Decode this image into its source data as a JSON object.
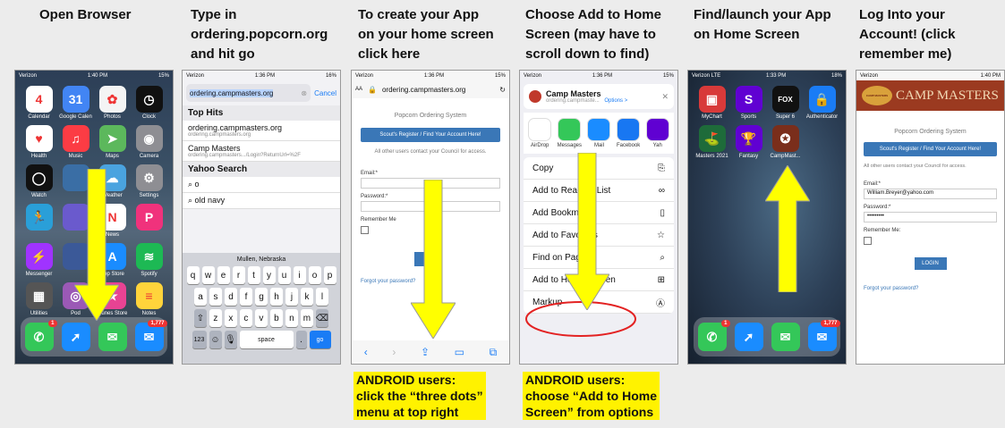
{
  "steps": [
    {
      "title": "Open Browser"
    },
    {
      "title": "Type in\nordering.popcorn.org\nand hit go"
    },
    {
      "title": "To create your App\non your home screen\nclick here"
    },
    {
      "title": "Choose Add to Home\nScreen (may have to\nscroll down to find)"
    },
    {
      "title": "Find/launch your App\non Home Screen"
    },
    {
      "title": "Log Into your\nAccount! (click\nremember me)"
    }
  ],
  "colors": {
    "arrow": "#ffff00",
    "highlight": "#fff200",
    "button_blue": "#3a77b7"
  },
  "phone1": {
    "status": {
      "carrier": "Verizon",
      "time": "1:40 PM",
      "battery": "15%"
    },
    "apps": [
      {
        "label": "Calendar",
        "glyph": "4",
        "color": "#ffffff",
        "icon": "calendar-icon"
      },
      {
        "label": "Google Calen",
        "glyph": "31",
        "color": "#4285f4",
        "icon": "google-calendar-icon"
      },
      {
        "label": "Photos",
        "glyph": "✿",
        "color": "#f4f4f4",
        "icon": "photos-icon"
      },
      {
        "label": "Clock",
        "glyph": "◷",
        "color": "#111111",
        "icon": "clock-icon"
      },
      {
        "label": "Health",
        "glyph": "♥",
        "color": "#ffffff",
        "icon": "health-icon"
      },
      {
        "label": "Music",
        "glyph": "♫",
        "color": "#fc3c44",
        "icon": "music-icon"
      },
      {
        "label": "Maps",
        "glyph": "➤",
        "color": "#5cb85c",
        "icon": "maps-icon"
      },
      {
        "label": "Camera",
        "glyph": "◉",
        "color": "#8e8e93",
        "icon": "camera-icon"
      },
      {
        "label": "Watch",
        "glyph": "◯",
        "color": "#111111",
        "icon": "watch-icon"
      },
      {
        "label": "",
        "glyph": "",
        "color": "#3a6ea5",
        "icon": "app-icon"
      },
      {
        "label": "Weather",
        "glyph": "☁",
        "color": "#4aa3df",
        "icon": "weather-icon"
      },
      {
        "label": "Settings",
        "glyph": "⚙",
        "color": "#8e8e93",
        "icon": "settings-icon"
      },
      {
        "label": "",
        "glyph": "🏃",
        "color": "#2a9fd8",
        "icon": "fitness-icon"
      },
      {
        "label": "",
        "glyph": "",
        "color": "#6a5acd",
        "icon": "app-icon"
      },
      {
        "label": "News",
        "glyph": "N",
        "color": "#ffffff",
        "icon": "news-icon"
      },
      {
        "label": "",
        "glyph": "P",
        "color": "#f0327c",
        "icon": "app-icon"
      },
      {
        "label": "Messenger",
        "glyph": "⚡",
        "color": "#a033ff",
        "icon": "messenger-icon"
      },
      {
        "label": "",
        "glyph": "",
        "color": "#3b5998",
        "icon": "app-icon"
      },
      {
        "label": "App Store",
        "glyph": "A",
        "color": "#1a8cff",
        "icon": "app-store-icon"
      },
      {
        "label": "Spotify",
        "glyph": "≋",
        "color": "#1db954",
        "icon": "spotify-icon"
      },
      {
        "label": "Utilities",
        "glyph": "▦",
        "color": "#555555",
        "icon": "utilities-folder-icon"
      },
      {
        "label": "Pod",
        "glyph": "◎",
        "color": "#9b59b6",
        "icon": "podcasts-icon"
      },
      {
        "label": "iTunes Store",
        "glyph": "★",
        "color": "#e84393",
        "icon": "itunes-store-icon"
      },
      {
        "label": "Notes",
        "glyph": "≡",
        "color": "#ffd43b",
        "icon": "notes-icon"
      }
    ],
    "dock": [
      {
        "glyph": "✆",
        "color": "#34c759",
        "icon": "phone-icon",
        "badge": "1"
      },
      {
        "glyph": "➚",
        "color": "#1a8cff",
        "icon": "safari-icon",
        "badge": ""
      },
      {
        "glyph": "✉",
        "color": "#34c759",
        "icon": "messages-icon",
        "badge": ""
      },
      {
        "glyph": "✉",
        "color": "#1a8cff",
        "icon": "mail-icon",
        "badge": "1,777"
      }
    ]
  },
  "phone2": {
    "status": {
      "carrier": "Verizon",
      "time": "1:36 PM",
      "battery": "16%"
    },
    "url": "ordering.campmasters.org",
    "cancel": "Cancel",
    "top_hits": "Top Hits",
    "hit1": {
      "title": "ordering.campmasters.org",
      "sub": "ordering.campmasters.org"
    },
    "hit2": {
      "title": "Camp Masters",
      "sub": "ordering.campmasters.../Login?ReturnUrl=%2F"
    },
    "yahoo": "Yahoo Search",
    "s1": "o",
    "s2": "old navy",
    "location": "Mullen, Nebraska",
    "keys_row1": [
      "q",
      "w",
      "e",
      "r",
      "t",
      "y",
      "u",
      "i",
      "o",
      "p"
    ],
    "keys_row2": [
      "a",
      "s",
      "d",
      "f",
      "g",
      "h",
      "j",
      "k",
      "l"
    ],
    "keys_row3": [
      "z",
      "x",
      "c",
      "v",
      "b",
      "n",
      "m"
    ],
    "key_123": "123",
    "key_space": "space",
    "key_go": "go"
  },
  "phone3": {
    "status": {
      "carrier": "Verizon",
      "time": "1:36 PM",
      "battery": "15%"
    },
    "aa": "AA",
    "url": "ordering.campmasters.org",
    "heading": "Popcorn Ordering System",
    "register": "Scout's Register / Find Your Account Here!",
    "others": "All other users contact your Council for access.",
    "email": "Email:*",
    "password": "Password:*",
    "remember": "Remember Me",
    "forgot": "Forgot your password?"
  },
  "phone4": {
    "status": {
      "carrier": "Verizon",
      "time": "1:36 PM",
      "battery": "15%"
    },
    "site_title": "Camp Masters",
    "site_sub": "ordering.campmaste...",
    "options": "Options >",
    "share_apps": [
      {
        "label": "AirDrop",
        "color": "#ffffff",
        "icon": "airdrop-icon"
      },
      {
        "label": "Messages",
        "color": "#34c759",
        "icon": "messages-icon"
      },
      {
        "label": "Mail",
        "color": "#1a8cff",
        "icon": "mail-icon"
      },
      {
        "label": "Facebook",
        "color": "#1877f2",
        "icon": "facebook-icon"
      },
      {
        "label": "Yah",
        "color": "#6001d2",
        "icon": "yahoo-icon"
      }
    ],
    "actions": [
      {
        "label": "Copy",
        "icon": "copy-icon",
        "glyph": "⎘"
      },
      {
        "label": "Add to Reading List",
        "icon": "reading-list-icon",
        "glyph": "∞"
      },
      {
        "label": "Add Bookmark",
        "icon": "bookmark-icon",
        "glyph": "▯"
      },
      {
        "label": "Add to Favorites",
        "icon": "favorites-icon",
        "glyph": "☆"
      },
      {
        "label": "Find on Page",
        "icon": "search-icon",
        "glyph": "⌕"
      },
      {
        "label": "Add to Home Screen",
        "icon": "add-square-icon",
        "glyph": "⊞"
      },
      {
        "label": "Markup",
        "icon": "markup-icon",
        "glyph": "Ⓐ"
      }
    ]
  },
  "phone5": {
    "status": {
      "carrier": "Verizon",
      "network": "LTE",
      "time": "1:33 PM",
      "battery": "18%"
    },
    "apps": [
      {
        "label": "MyChart",
        "glyph": "▣",
        "color": "#d83a3a",
        "icon": "mychart-icon"
      },
      {
        "label": "Sports",
        "glyph": "S",
        "color": "#6001d2",
        "icon": "yahoo-sports-icon"
      },
      {
        "label": "Super 6",
        "glyph": "FOX",
        "color": "#111111",
        "icon": "fox-bet-icon"
      },
      {
        "label": "Authenticator",
        "glyph": "🔒",
        "color": "#1a7cf5",
        "icon": "authenticator-icon"
      },
      {
        "label": "Masters 2021",
        "glyph": "⛳",
        "color": "#1e6b3a",
        "icon": "masters-icon"
      },
      {
        "label": "Fantasy",
        "glyph": "🏆",
        "color": "#6001d2",
        "icon": "yahoo-fantasy-icon"
      },
      {
        "label": "CampMast...",
        "glyph": "✪",
        "color": "#7a2e1b",
        "icon": "campmasters-icon"
      }
    ],
    "dock": [
      {
        "glyph": "✆",
        "color": "#34c759",
        "icon": "phone-icon",
        "badge": "1"
      },
      {
        "glyph": "➚",
        "color": "#1a8cff",
        "icon": "safari-icon",
        "badge": ""
      },
      {
        "glyph": "✉",
        "color": "#34c759",
        "icon": "messages-icon",
        "badge": ""
      },
      {
        "glyph": "✉",
        "color": "#1a8cff",
        "icon": "mail-icon",
        "badge": "1,777"
      }
    ]
  },
  "phone6": {
    "status": {
      "carrier": "Verizon",
      "time": "1:40 PM"
    },
    "logo_badge": "CAMP MASTERS",
    "logo_text": "CAMP MASTERS",
    "heading": "Popcorn Ordering System",
    "register": "Scout's Register / Find Your Account Here!",
    "others": "All other users contact your Council for access.",
    "email_label": "Email:*",
    "email_value": "William.Breyer@yahoo.com",
    "password_label": "Password:*",
    "password_value": "•••••••••",
    "remember": "Remember Me:",
    "login": "LOGIN",
    "forgot": "Forgot your password?"
  },
  "android": [
    {
      "text": "ANDROID users:\nclick the “three dots”\nmenu at top right"
    },
    {
      "text": "ANDROID users:\nchoose “Add to Home\nScreen” from options"
    }
  ]
}
